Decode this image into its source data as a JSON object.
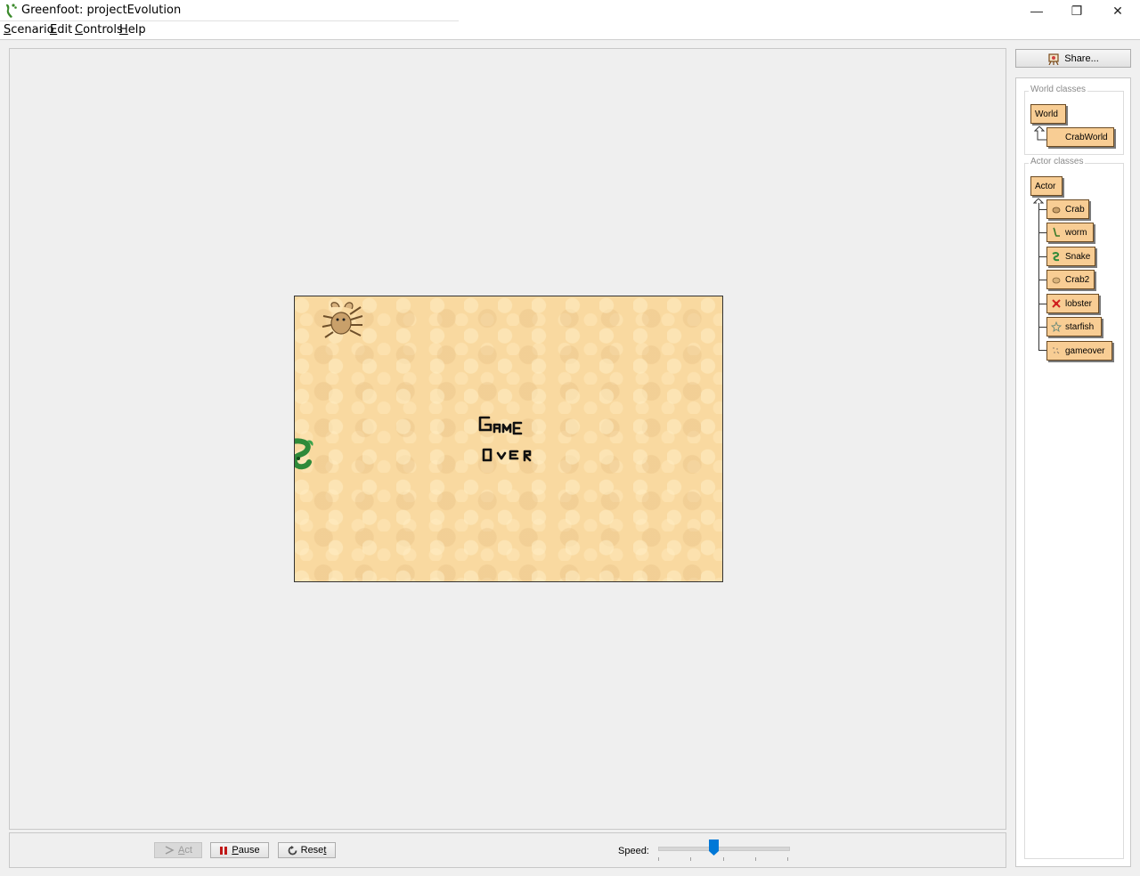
{
  "window": {
    "title": "Greenfoot: projectEvolution",
    "controls": {
      "minimize": "—",
      "restore": "❐",
      "close": "✕"
    }
  },
  "menu": [
    {
      "u": "S",
      "rest": "cenario"
    },
    {
      "u": "E",
      "rest": "dit"
    },
    {
      "u": "C",
      "rest": "ontrols"
    },
    {
      "u": "H",
      "rest": "elp"
    }
  ],
  "controls": {
    "act": {
      "u": "A",
      "rest": "ct"
    },
    "pause": {
      "u": "P",
      "rest": "ause"
    },
    "reset": {
      "pre": "Rese",
      "u": "t"
    },
    "speed_label": "Speed:",
    "speed_value": 0.43
  },
  "share": {
    "label": "Share..."
  },
  "world_classes": {
    "title": "World classes",
    "items": [
      "World",
      "CrabWorld"
    ]
  },
  "actor_classes": {
    "title": "Actor classes",
    "root": "Actor",
    "items": [
      "Crab",
      "worm",
      "Snake",
      "Crab2",
      "lobster",
      "starfish",
      "gameover"
    ]
  },
  "colors": {
    "class_fill": "#f8cd94",
    "world_bg": "#f9d9a0",
    "slider_accent": "#0078d7"
  }
}
